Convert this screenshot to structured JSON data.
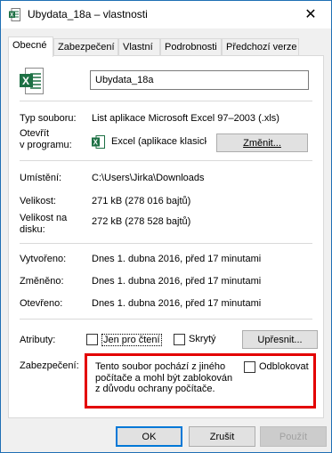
{
  "window": {
    "title": "Ubydata_18a – vlastnosti",
    "close_label": "✕"
  },
  "tabs": [
    {
      "label": "Obecné",
      "active": true
    },
    {
      "label": "Zabezpečení",
      "active": false
    },
    {
      "label": "Vlastní",
      "active": false
    },
    {
      "label": "Podrobnosti",
      "active": false
    },
    {
      "label": "Předchozí verze",
      "active": false
    }
  ],
  "file": {
    "name": "Ubydata_18a",
    "type_label": "Typ souboru:",
    "type_value": "List aplikace Microsoft Excel 97–2003 (.xls)",
    "opens_with_label_1": "Otevřít",
    "opens_with_label_2": "v programu:",
    "opens_with_value": "Excel (aplikace klasické",
    "change_button": "Změnit...",
    "location_label": "Umístění:",
    "location_value": "C:\\Users\\Jirka\\Downloads",
    "size_label": "Velikost:",
    "size_value": "271 kB (278 016 bajtů)",
    "size_on_disk_label_1": "Velikost na",
    "size_on_disk_label_2": "disku:",
    "size_on_disk_value": "272 kB (278 528 bajtů)",
    "created_label": "Vytvořeno:",
    "created_value": "Dnes 1. dubna 2016, před 17 minutami",
    "modified_label": "Změněno:",
    "modified_value": "Dnes 1. dubna 2016, před 17 minutami",
    "accessed_label": "Otevřeno:",
    "accessed_value": "Dnes 1. dubna 2016, před 17 minutami"
  },
  "attributes": {
    "label": "Atributy:",
    "readonly_label": "Jen pro čtení",
    "readonly_checked": false,
    "hidden_label": "Skrytý",
    "hidden_checked": false,
    "advanced_button": "Upřesnit..."
  },
  "security": {
    "label": "Zabezpečení:",
    "message": "Tento soubor pochází z jiného počítače a mohl být zablokován z důvodu ochrany počítače.",
    "unblock_label": "Odblokovat",
    "unblock_checked": false,
    "highlight_color": "#e30000"
  },
  "buttons": {
    "ok": "OK",
    "cancel": "Zrušit",
    "apply": "Použít"
  },
  "icons": {
    "title": "excel-file-icon",
    "file": "excel-file-icon",
    "program": "excel-app-icon"
  },
  "colors": {
    "excel_green": "#1d7044",
    "window_border": "#1f6fb4"
  }
}
